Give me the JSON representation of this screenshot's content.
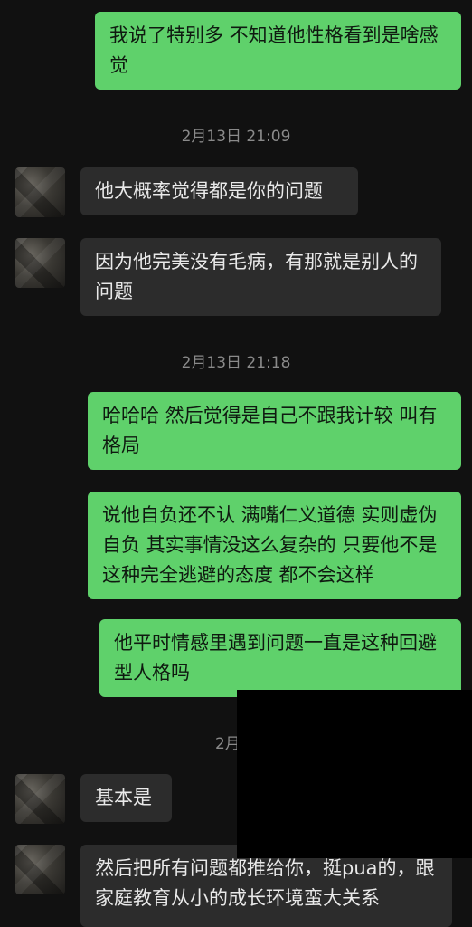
{
  "messages": [
    {
      "type": "sent",
      "text": "我说了特别多 不知道他性格看到是啥感觉"
    },
    {
      "type": "timestamp",
      "text": "2月13日 21:09"
    },
    {
      "type": "received",
      "text": "他大概率觉得都是你的问题"
    },
    {
      "type": "received",
      "text": "因为他完美没有毛病，有那就是别人的问题"
    },
    {
      "type": "timestamp",
      "text": "2月13日 21:18"
    },
    {
      "type": "sent",
      "text": "哈哈哈 然后觉得是自己不跟我计较 叫有格局"
    },
    {
      "type": "sent",
      "text": "说他自负还不认 满嘴仁义道德 实则虚伪自负 其实事情没这么复杂的 只要他不是这种完全逃避的态度 都不会这样"
    },
    {
      "type": "sent",
      "text": "他平时情感里遇到问题一直是这种回避型人格吗"
    },
    {
      "type": "timestamp",
      "text": "2月"
    },
    {
      "type": "received",
      "text": "基本是"
    },
    {
      "type": "received",
      "text": "然后把所有问题都推给你，挺pua的，跟家庭教育从小的成长环境蛮大关系"
    }
  ],
  "colors": {
    "background": "#111111",
    "sent_bubble": "#5fd16b",
    "received_bubble": "#2c2c2c",
    "timestamp": "#8a8a8a"
  }
}
